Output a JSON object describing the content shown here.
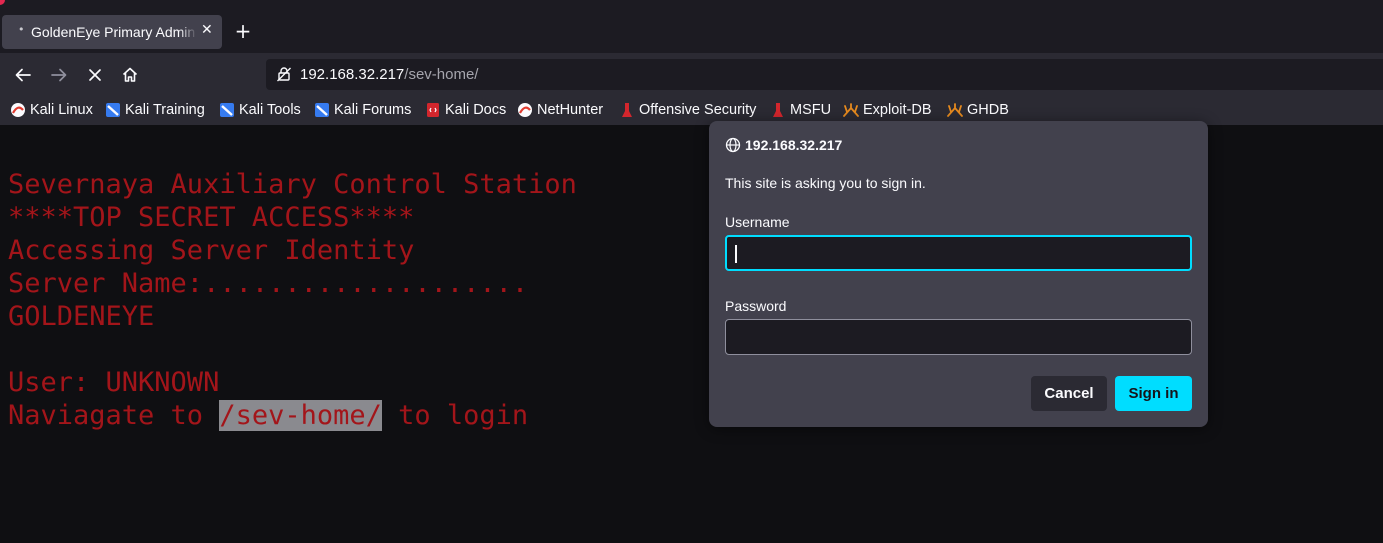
{
  "tab": {
    "title": "GoldenEye Primary Admin Server",
    "dot": "•",
    "close_label": "✕"
  },
  "new_tab_label": "+",
  "url": {
    "host": "192.168.32.217",
    "path": "/sev-home/"
  },
  "bookmarks": [
    {
      "label": "Kali Linux",
      "icon": "kali-dragon-icon"
    },
    {
      "label": "Kali Training",
      "icon": "kali-training-icon"
    },
    {
      "label": "Kali Tools",
      "icon": "kali-tools-icon"
    },
    {
      "label": "Kali Forums",
      "icon": "kali-forums-icon"
    },
    {
      "label": "Kali Docs",
      "icon": "kali-docs-icon"
    },
    {
      "label": "NetHunter",
      "icon": "nethunter-icon"
    },
    {
      "label": "Offensive Security",
      "icon": "offsec-icon"
    },
    {
      "label": "MSFU",
      "icon": "msfu-icon"
    },
    {
      "label": "Exploit-DB",
      "icon": "exploit-db-icon"
    },
    {
      "label": "GHDB",
      "icon": "ghdb-icon"
    }
  ],
  "page": {
    "lines": [
      "Severnaya Auxiliary Control Station",
      "****TOP SECRET ACCESS****",
      "Accessing Server Identity",
      "Server Name:....................",
      "GOLDENEYE",
      "",
      "User: UNKNOWN"
    ],
    "last_line_prefix": "Naviagate to ",
    "last_line_highlight": "/sev-home/",
    "last_line_suffix": " to login"
  },
  "dialog": {
    "host": "192.168.32.217",
    "message": "This site is asking you to sign in.",
    "username_label": "Username",
    "username_value": "",
    "password_label": "Password",
    "password_value": "",
    "cancel_label": "Cancel",
    "signin_label": "Sign in"
  },
  "colors": {
    "terminal_text": "#a3151a",
    "accent": "#00ddff",
    "dialog_bg": "#42414d",
    "chrome_bg": "#2b2a33"
  }
}
